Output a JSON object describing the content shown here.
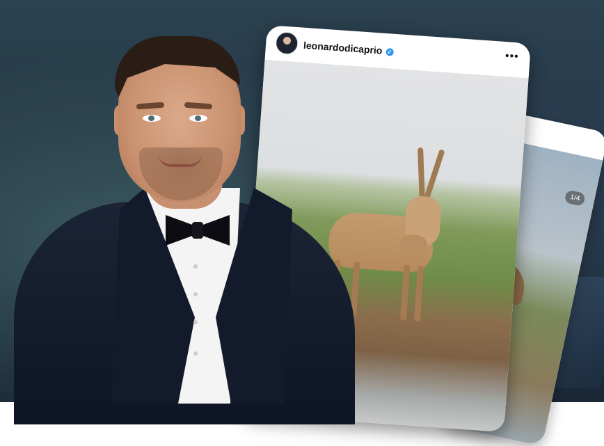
{
  "post": {
    "username": "leonardodicaprio",
    "verified": true,
    "counter": "1/4"
  },
  "icons": {
    "verified": "verified-badge-icon",
    "more": "more-options-icon"
  },
  "colors": {
    "verified_blue": "#3897f0",
    "background": "#24384a"
  }
}
